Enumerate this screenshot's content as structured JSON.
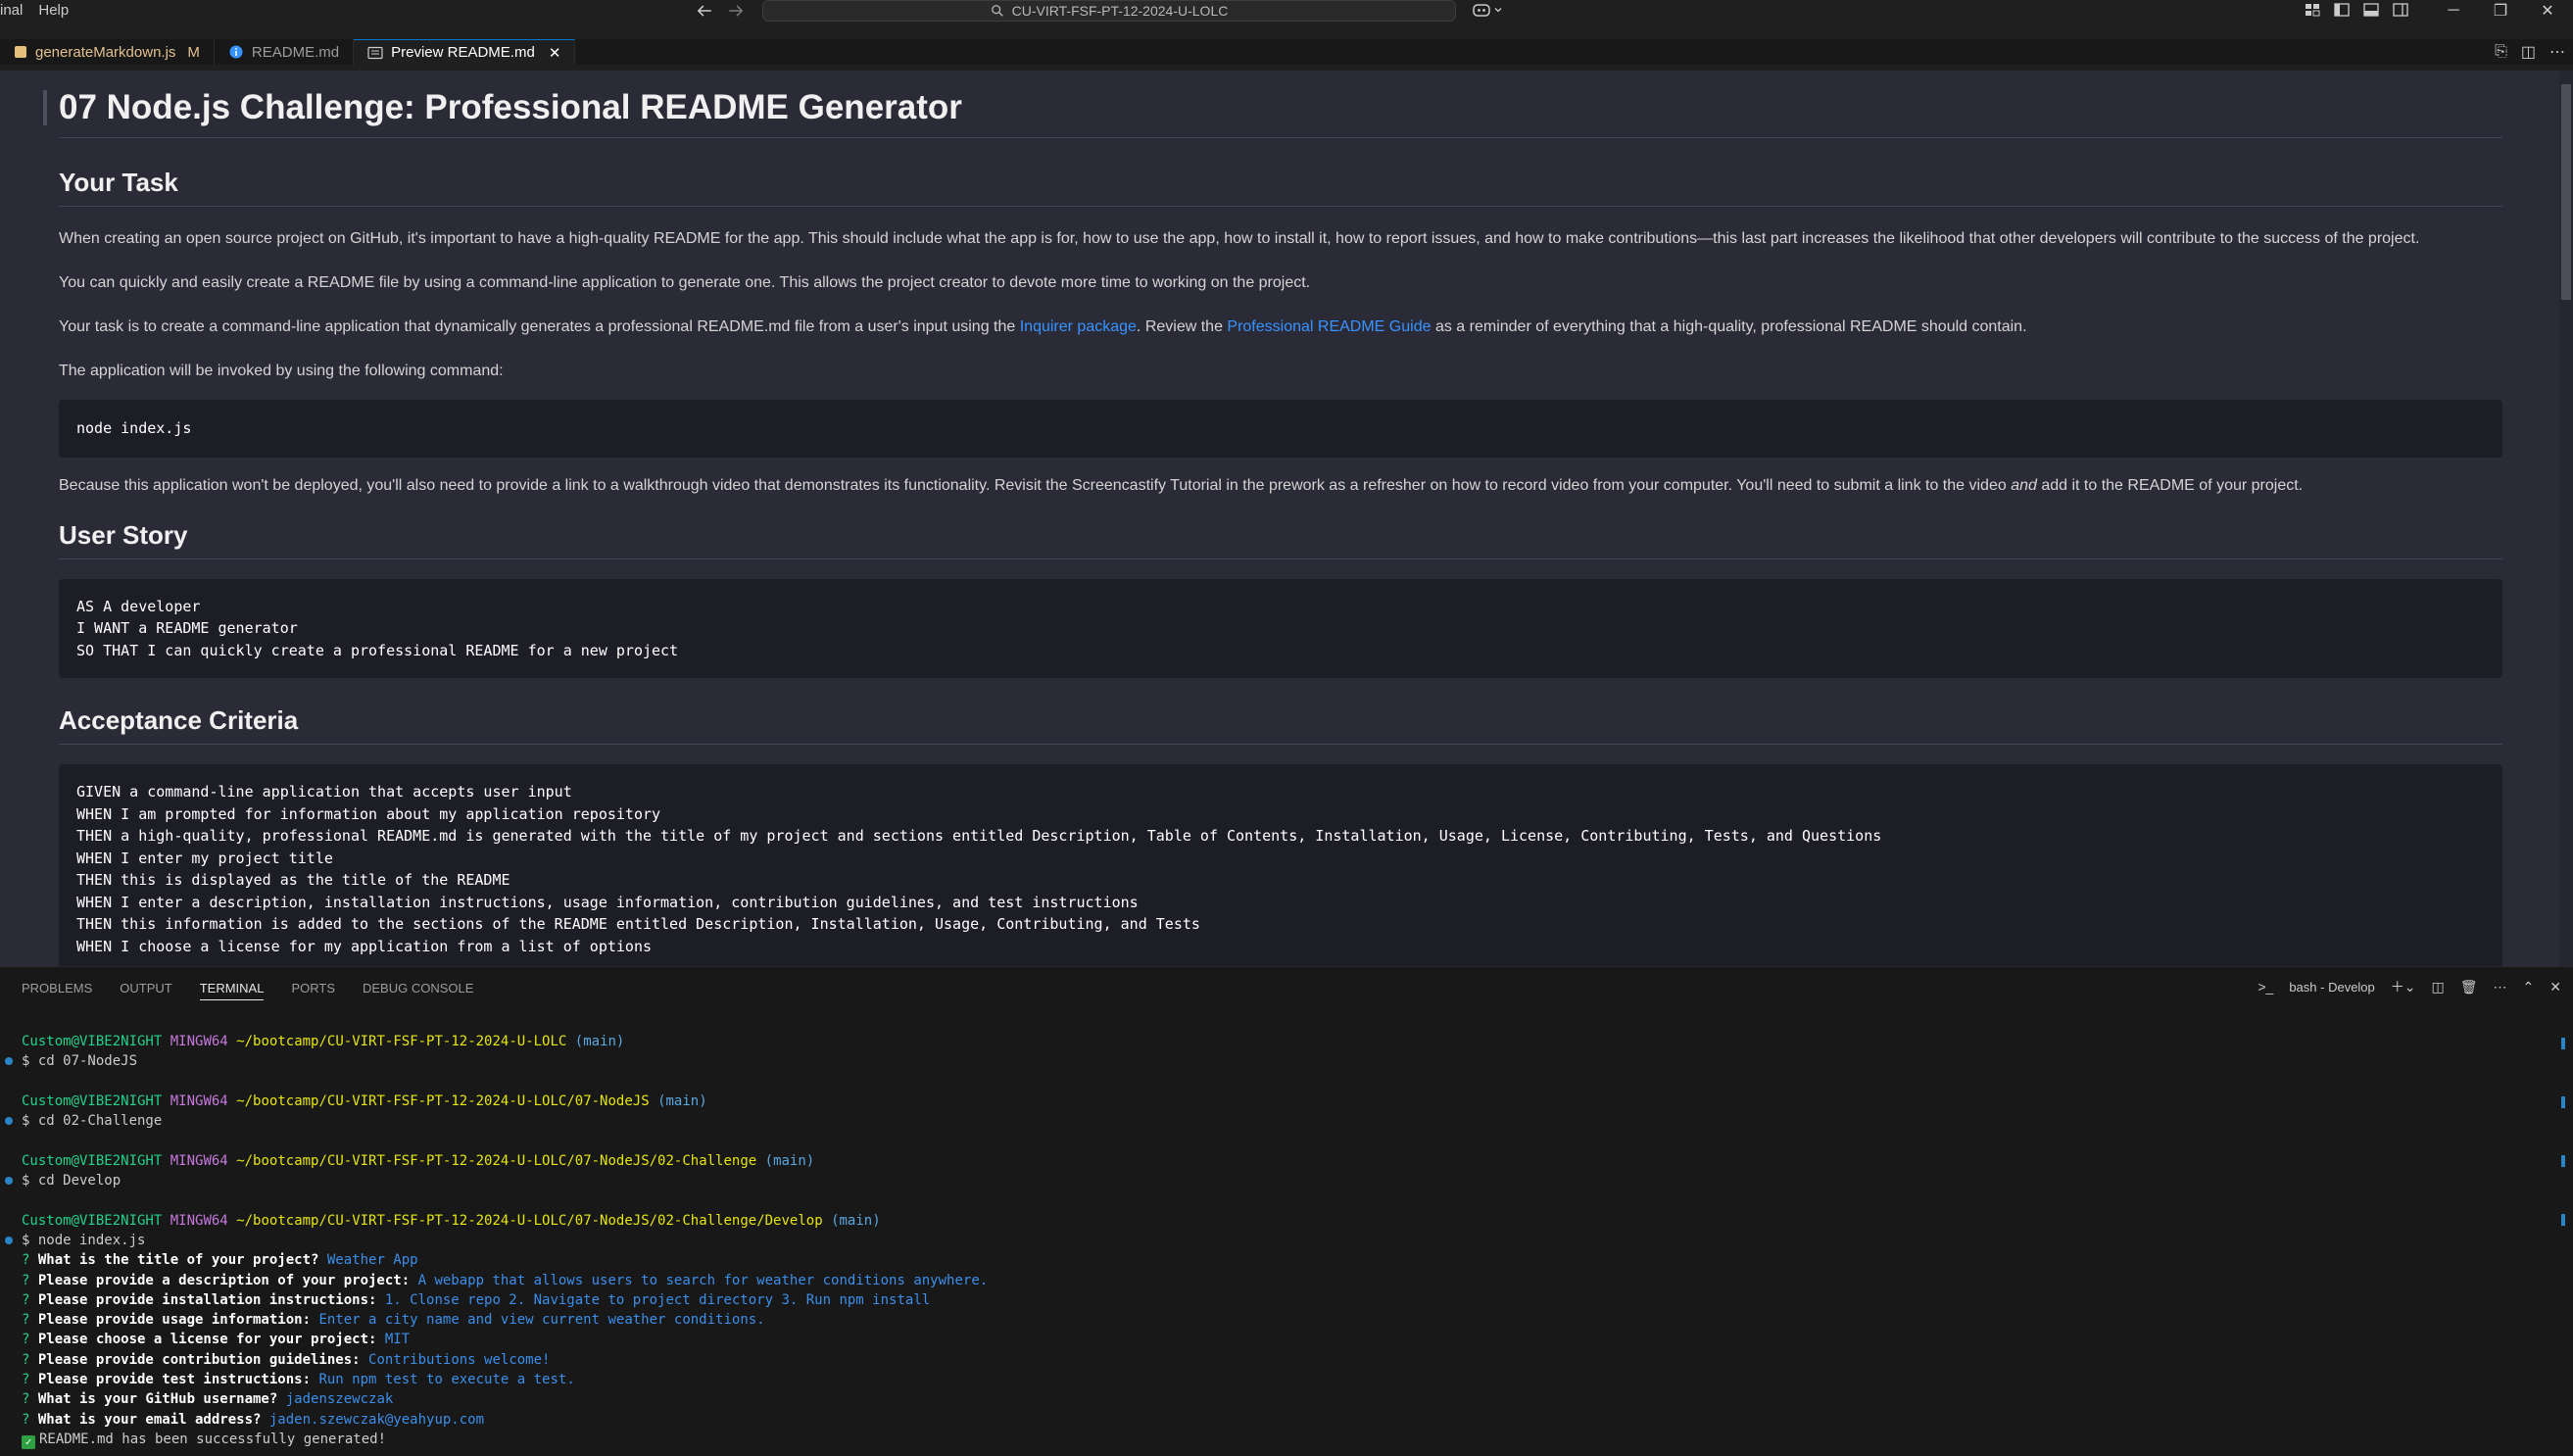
{
  "menu": [
    "inal",
    "Help"
  ],
  "search": {
    "text": "CU-VIRT-FSF-PT-12-2024-U-LOLC"
  },
  "tabs": [
    {
      "label": "generateMarkdown.js",
      "badge": "M"
    },
    {
      "label": "README.md"
    },
    {
      "label": "Preview README.md",
      "close": "✕"
    }
  ],
  "readme": {
    "title": "07 Node.js Challenge: Professional README Generator",
    "task_heading": "Your Task",
    "p1": "When creating an open source project on GitHub, it's important to have a high-quality README for the app. This should include what the app is for, how to use the app, how to install it, how to report issues, and how to make contributions—this last part increases the likelihood that other developers will contribute to the success of the project.",
    "p2": "You can quickly and easily create a README file by using a command-line application to generate one. This allows the project creator to devote more time to working on the project.",
    "p3_a": "Your task is to create a command-line application that dynamically generates a professional README.md file from a user's input using the ",
    "p3_link1": "Inquirer package",
    "p3_b": ". Review the ",
    "p3_link2": "Professional README Guide",
    "p3_c": " as a reminder of everything that a high-quality, professional README should contain.",
    "p4": "The application will be invoked by using the following command:",
    "code1": "node index.js",
    "p5_a": "Because this application won't be deployed, you'll also need to provide a link to a walkthrough video that demonstrates its functionality. Revisit the Screencastify Tutorial in the prework as a refresher on how to record video from your computer. You'll need to submit a link to the video ",
    "p5_em": "and",
    "p5_b": " add it to the README of your project.",
    "story_heading": "User Story",
    "story_code": "AS A developer\nI WANT a README generator\nSO THAT I can quickly create a professional README for a new project",
    "criteria_heading": "Acceptance Criteria",
    "criteria_code": "GIVEN a command-line application that accepts user input\nWHEN I am prompted for information about my application repository\nTHEN a high-quality, professional README.md is generated with the title of my project and sections entitled Description, Table of Contents, Installation, Usage, License, Contributing, Tests, and Questions\nWHEN I enter my project title\nTHEN this is displayed as the title of the README\nWHEN I enter a description, installation instructions, usage information, contribution guidelines, and test instructions\nTHEN this information is added to the sections of the README entitled Description, Installation, Usage, Contributing, and Tests\nWHEN I choose a license for my application from a list of options"
  },
  "panel": {
    "tabs": [
      "PROBLEMS",
      "OUTPUT",
      "TERMINAL",
      "PORTS",
      "DEBUG CONSOLE"
    ],
    "active_tab": "TERMINAL",
    "terminal_name": "bash - Develop"
  },
  "terminal": {
    "user": "Custom@VIBE2NIGHT",
    "shell": "MINGW64",
    "branch": "(main)",
    "paths": [
      "~/bootcamp/CU-VIRT-FSF-PT-12-2024-U-LOLC",
      "~/bootcamp/CU-VIRT-FSF-PT-12-2024-U-LOLC/07-NodeJS",
      "~/bootcamp/CU-VIRT-FSF-PT-12-2024-U-LOLC/07-NodeJS/02-Challenge",
      "~/bootcamp/CU-VIRT-FSF-PT-12-2024-U-LOLC/07-NodeJS/02-Challenge/Develop"
    ],
    "commands": [
      "$ cd 07-NodeJS",
      "$ cd 02-Challenge",
      "$ cd Develop",
      "$ node index.js"
    ],
    "prompts": [
      {
        "q": "What is the title of your project?",
        "a": "Weather App"
      },
      {
        "q": "Please provide a description of your project:",
        "a": "A webapp that allows users to search for weather conditions anywhere."
      },
      {
        "q": "Please provide installation instructions:",
        "a": "1. Clonse repo 2. Navigate to project directory 3. Run npm install"
      },
      {
        "q": "Please provide usage information:",
        "a": "Enter a city name and view current weather conditions."
      },
      {
        "q": "Please choose a license for your project:",
        "a": "MIT"
      },
      {
        "q": "Please provide contribution guidelines:",
        "a": "Contributions welcome!"
      },
      {
        "q": "Please provide test instructions:",
        "a": "Run npm test to execute a test."
      },
      {
        "q": "What is your GitHub username?",
        "a": "jadenszewczak"
      },
      {
        "q": "What is your email address?",
        "a": "jaden.szewczak@yeahyup.com"
      }
    ],
    "done": "README.md has been successfully generated!"
  }
}
